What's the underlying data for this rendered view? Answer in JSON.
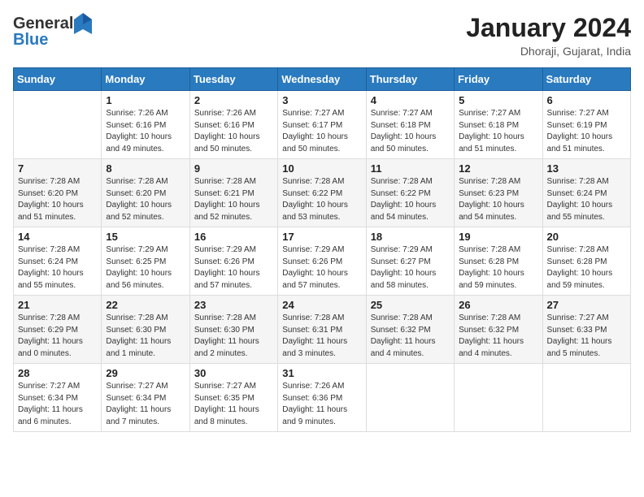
{
  "header": {
    "logo_general": "General",
    "logo_blue": "Blue",
    "month_year": "January 2024",
    "location": "Dhoraji, Gujarat, India"
  },
  "days_of_week": [
    "Sunday",
    "Monday",
    "Tuesday",
    "Wednesday",
    "Thursday",
    "Friday",
    "Saturday"
  ],
  "weeks": [
    [
      {
        "day": "",
        "info": ""
      },
      {
        "day": "1",
        "info": "Sunrise: 7:26 AM\nSunset: 6:16 PM\nDaylight: 10 hours\nand 49 minutes."
      },
      {
        "day": "2",
        "info": "Sunrise: 7:26 AM\nSunset: 6:16 PM\nDaylight: 10 hours\nand 50 minutes."
      },
      {
        "day": "3",
        "info": "Sunrise: 7:27 AM\nSunset: 6:17 PM\nDaylight: 10 hours\nand 50 minutes."
      },
      {
        "day": "4",
        "info": "Sunrise: 7:27 AM\nSunset: 6:18 PM\nDaylight: 10 hours\nand 50 minutes."
      },
      {
        "day": "5",
        "info": "Sunrise: 7:27 AM\nSunset: 6:18 PM\nDaylight: 10 hours\nand 51 minutes."
      },
      {
        "day": "6",
        "info": "Sunrise: 7:27 AM\nSunset: 6:19 PM\nDaylight: 10 hours\nand 51 minutes."
      }
    ],
    [
      {
        "day": "7",
        "info": "Sunrise: 7:28 AM\nSunset: 6:20 PM\nDaylight: 10 hours\nand 51 minutes."
      },
      {
        "day": "8",
        "info": "Sunrise: 7:28 AM\nSunset: 6:20 PM\nDaylight: 10 hours\nand 52 minutes."
      },
      {
        "day": "9",
        "info": "Sunrise: 7:28 AM\nSunset: 6:21 PM\nDaylight: 10 hours\nand 52 minutes."
      },
      {
        "day": "10",
        "info": "Sunrise: 7:28 AM\nSunset: 6:22 PM\nDaylight: 10 hours\nand 53 minutes."
      },
      {
        "day": "11",
        "info": "Sunrise: 7:28 AM\nSunset: 6:22 PM\nDaylight: 10 hours\nand 54 minutes."
      },
      {
        "day": "12",
        "info": "Sunrise: 7:28 AM\nSunset: 6:23 PM\nDaylight: 10 hours\nand 54 minutes."
      },
      {
        "day": "13",
        "info": "Sunrise: 7:28 AM\nSunset: 6:24 PM\nDaylight: 10 hours\nand 55 minutes."
      }
    ],
    [
      {
        "day": "14",
        "info": "Sunrise: 7:28 AM\nSunset: 6:24 PM\nDaylight: 10 hours\nand 55 minutes."
      },
      {
        "day": "15",
        "info": "Sunrise: 7:29 AM\nSunset: 6:25 PM\nDaylight: 10 hours\nand 56 minutes."
      },
      {
        "day": "16",
        "info": "Sunrise: 7:29 AM\nSunset: 6:26 PM\nDaylight: 10 hours\nand 57 minutes."
      },
      {
        "day": "17",
        "info": "Sunrise: 7:29 AM\nSunset: 6:26 PM\nDaylight: 10 hours\nand 57 minutes."
      },
      {
        "day": "18",
        "info": "Sunrise: 7:29 AM\nSunset: 6:27 PM\nDaylight: 10 hours\nand 58 minutes."
      },
      {
        "day": "19",
        "info": "Sunrise: 7:28 AM\nSunset: 6:28 PM\nDaylight: 10 hours\nand 59 minutes."
      },
      {
        "day": "20",
        "info": "Sunrise: 7:28 AM\nSunset: 6:28 PM\nDaylight: 10 hours\nand 59 minutes."
      }
    ],
    [
      {
        "day": "21",
        "info": "Sunrise: 7:28 AM\nSunset: 6:29 PM\nDaylight: 11 hours\nand 0 minutes."
      },
      {
        "day": "22",
        "info": "Sunrise: 7:28 AM\nSunset: 6:30 PM\nDaylight: 11 hours\nand 1 minute."
      },
      {
        "day": "23",
        "info": "Sunrise: 7:28 AM\nSunset: 6:30 PM\nDaylight: 11 hours\nand 2 minutes."
      },
      {
        "day": "24",
        "info": "Sunrise: 7:28 AM\nSunset: 6:31 PM\nDaylight: 11 hours\nand 3 minutes."
      },
      {
        "day": "25",
        "info": "Sunrise: 7:28 AM\nSunset: 6:32 PM\nDaylight: 11 hours\nand 4 minutes."
      },
      {
        "day": "26",
        "info": "Sunrise: 7:28 AM\nSunset: 6:32 PM\nDaylight: 11 hours\nand 4 minutes."
      },
      {
        "day": "27",
        "info": "Sunrise: 7:27 AM\nSunset: 6:33 PM\nDaylight: 11 hours\nand 5 minutes."
      }
    ],
    [
      {
        "day": "28",
        "info": "Sunrise: 7:27 AM\nSunset: 6:34 PM\nDaylight: 11 hours\nand 6 minutes."
      },
      {
        "day": "29",
        "info": "Sunrise: 7:27 AM\nSunset: 6:34 PM\nDaylight: 11 hours\nand 7 minutes."
      },
      {
        "day": "30",
        "info": "Sunrise: 7:27 AM\nSunset: 6:35 PM\nDaylight: 11 hours\nand 8 minutes."
      },
      {
        "day": "31",
        "info": "Sunrise: 7:26 AM\nSunset: 6:36 PM\nDaylight: 11 hours\nand 9 minutes."
      },
      {
        "day": "",
        "info": ""
      },
      {
        "day": "",
        "info": ""
      },
      {
        "day": "",
        "info": ""
      }
    ]
  ]
}
